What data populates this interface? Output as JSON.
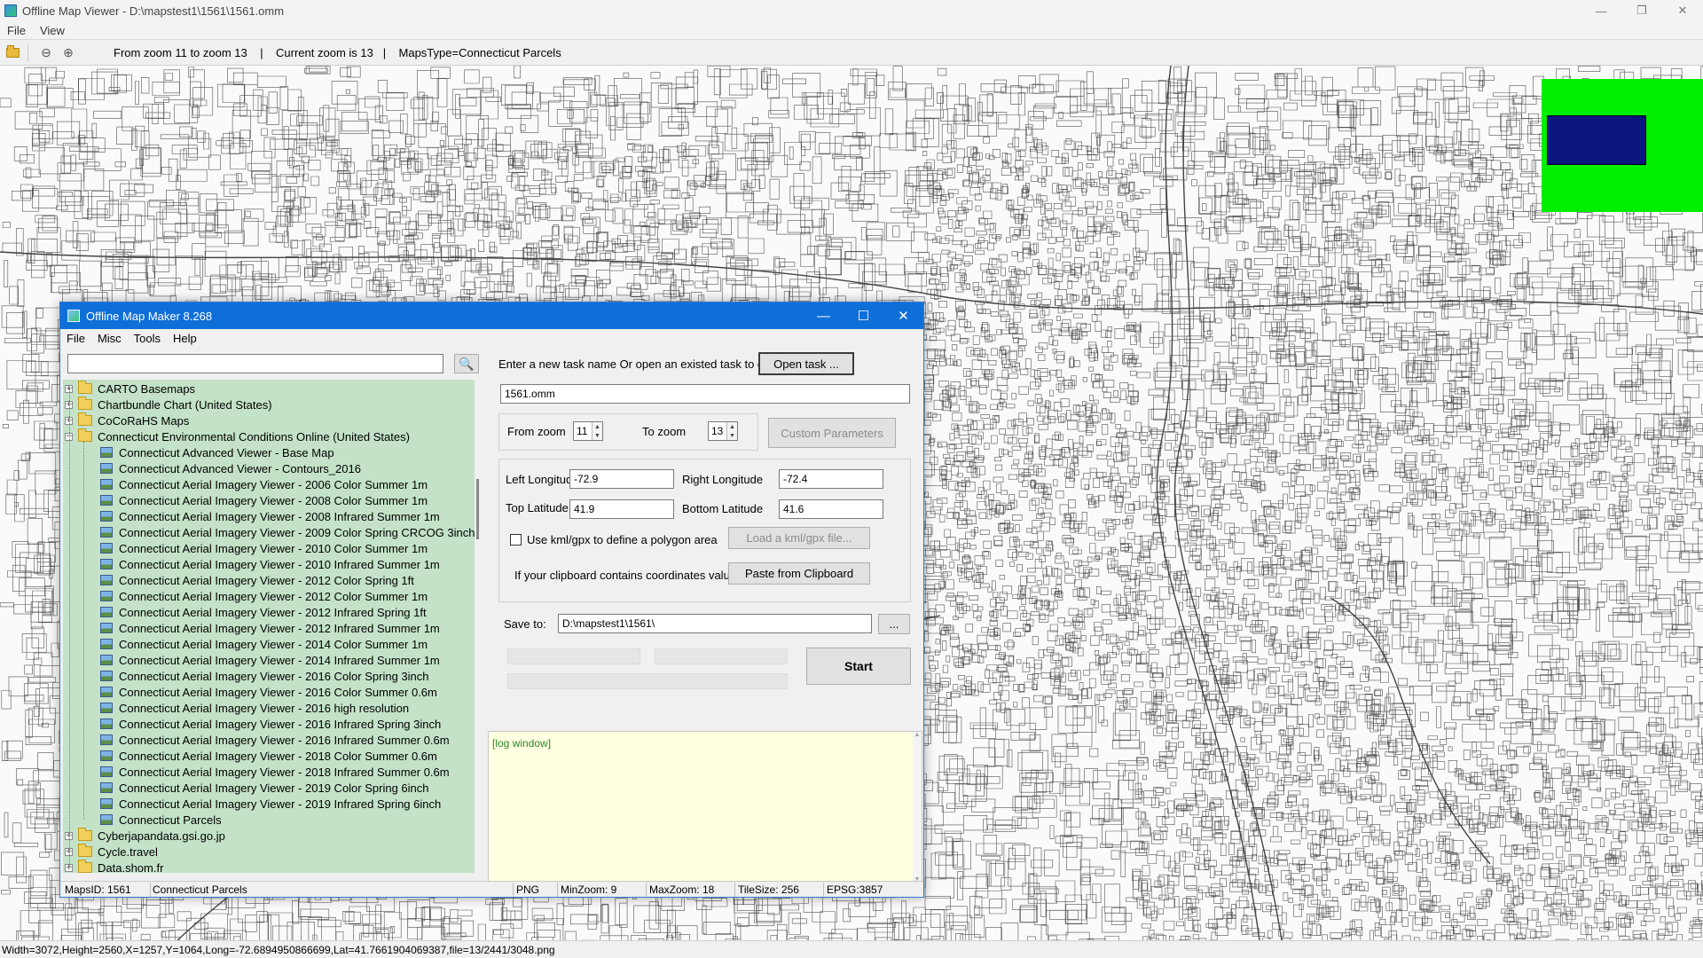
{
  "viewer": {
    "title": "Offline Map Viewer - D:\\mapstest1\\1561\\1561.omm",
    "menu": [
      "File",
      "View"
    ],
    "toolbar_info": "From zoom 11 to zoom 13    |    Current zoom is 13   |    MapsType=Connecticut Parcels",
    "status_text": "Width=3072,Height=2560,X=1257,Y=1064,Long=-72.6894950866699,Lat=41.7661904069387,file=13/2441/3048.png",
    "window_controls": [
      "minimize-icon",
      "restore-icon",
      "close-icon"
    ]
  },
  "minimap": {
    "background": "#00ee00",
    "viewport_color": "#0a1580"
  },
  "dialog": {
    "title": "Offline Map Maker 8.268",
    "menu": [
      "File",
      "Misc",
      "Tools",
      "Help"
    ],
    "search": {
      "value": "",
      "placeholder": ""
    },
    "tree": {
      "top_items": [
        "CARTO Basemaps",
        "Chartbundle Chart (United States)",
        "CoCoRaHS Maps"
      ],
      "expanded_folder": "Connecticut Environmental Conditions Online (United States)",
      "children": [
        "Connecticut Advanced Viewer - Base Map",
        "Connecticut Advanced Viewer - Contours_2016",
        "Connecticut Aerial Imagery Viewer - 2006 Color Summer 1m",
        "Connecticut Aerial Imagery Viewer - 2008 Color Summer 1m",
        "Connecticut Aerial Imagery Viewer - 2008 Infrared Summer 1m",
        "Connecticut Aerial Imagery Viewer - 2009 Color Spring CRCOG 3inch",
        "Connecticut Aerial Imagery Viewer - 2010 Color Summer 1m",
        "Connecticut Aerial Imagery Viewer - 2010 Infrared Summer 1m",
        "Connecticut Aerial Imagery Viewer - 2012 Color Spring 1ft",
        "Connecticut Aerial Imagery Viewer - 2012 Color Summer 1m",
        "Connecticut Aerial Imagery Viewer - 2012 Infrared Spring 1ft",
        "Connecticut Aerial Imagery Viewer - 2012 Infrared Summer 1m",
        "Connecticut Aerial Imagery Viewer - 2014 Color Summer 1m",
        "Connecticut Aerial Imagery Viewer - 2014 Infrared Summer 1m",
        "Connecticut Aerial Imagery Viewer - 2016 Color Spring 3inch",
        "Connecticut Aerial Imagery Viewer - 2016 Color Summer 0.6m",
        "Connecticut Aerial Imagery Viewer - 2016 high resolution",
        "Connecticut Aerial Imagery Viewer - 2016 Infrared Spring 3inch",
        "Connecticut Aerial Imagery Viewer - 2016 Infrared Summer 0.6m",
        "Connecticut Aerial Imagery Viewer - 2018 Color Summer 0.6m",
        "Connecticut Aerial Imagery Viewer - 2018 Infrared Summer 0.6m",
        "Connecticut Aerial Imagery Viewer - 2019 Color Spring 6inch",
        "Connecticut Aerial Imagery Viewer - 2019 Infrared Spring 6inch",
        "Connecticut Parcels"
      ],
      "bottom_items": [
        "Cyberjapandata.gsi.go.jp",
        "Cycle.travel",
        "Data.shom.fr"
      ],
      "background": "#c3e2c8"
    },
    "task_prompt": "Enter a new task name Or open an existed task to continue:",
    "open_task_label": "Open task ...",
    "task_name": "1561.omm",
    "from_zoom_label": "From zoom",
    "from_zoom": "11",
    "to_zoom_label": "To zoom",
    "to_zoom": "13",
    "custom_params_label": "Custom Parameters",
    "left_longitude_label": "Left Longitude",
    "left_longitude": "-72.9",
    "right_longitude_label": "Right Longitude",
    "right_longitude": "-72.4",
    "top_latitude_label": "Top Latitude",
    "top_latitude": "41.9",
    "bottom_latitude_label": "Bottom Latitude",
    "bottom_latitude": "41.6",
    "kml_label": "Use kml/gpx to define a polygon area",
    "load_kml_label": "Load a kml/gpx file...",
    "clipboard_prompt": "If your clipboard contains coordinates values:",
    "paste_label": "Paste from Clipboard",
    "save_to_label": "Save to:",
    "save_to": "D:\\mapstest1\\1561\\",
    "browse_label": "...",
    "start_label": "Start",
    "log_text": "[log window]",
    "log_background": "#ffffe1",
    "status": {
      "maps_id": "MapsID: 1561",
      "maps_name": "Connecticut Parcels",
      "format": "PNG",
      "min_zoom": "MinZoom: 9",
      "max_zoom": "MaxZoom: 18",
      "tile_size": "TileSize: 256",
      "epsg": "EPSG:3857"
    }
  }
}
